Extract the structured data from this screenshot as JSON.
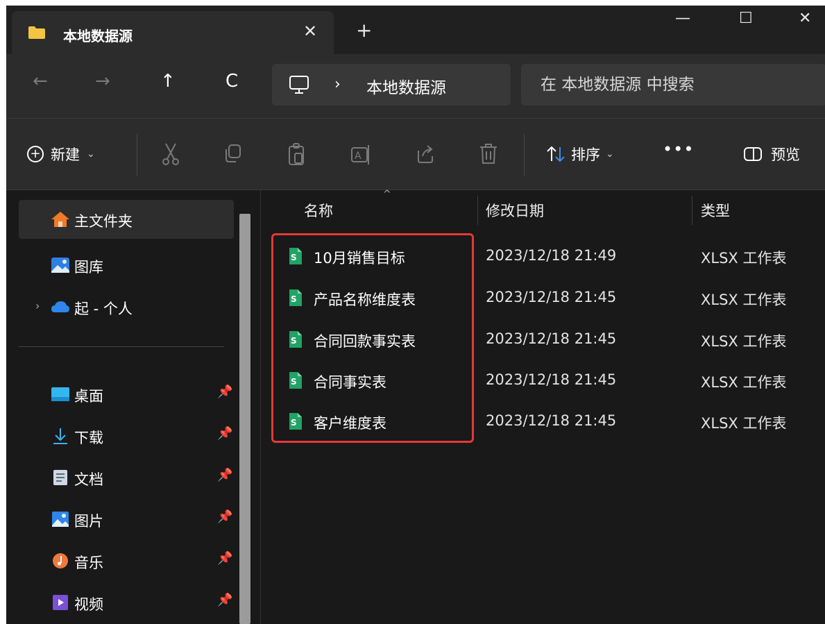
{
  "tab": {
    "title": "本地数据源",
    "close": "✕",
    "new_tab": "+"
  },
  "window_controls": {
    "minimize": "—",
    "maximize": "☐",
    "close": "✕"
  },
  "nav": {
    "back": "←",
    "forward": "→",
    "up": "↑",
    "refresh": "C"
  },
  "address": {
    "separator": "›",
    "crumb": "本地数据源"
  },
  "search": {
    "placeholder": "在 本地数据源 中搜索"
  },
  "toolbar": {
    "new_label": "新建",
    "caret": "⌄",
    "sort_label": "排序",
    "more_label": "•••",
    "preview_label": "预览"
  },
  "sidebar": {
    "items": [
      {
        "label": "主文件夹",
        "icon": "home-icon"
      },
      {
        "label": "图库",
        "icon": "gallery-icon"
      },
      {
        "label": "起 - 个人",
        "icon": "onedrive-icon"
      },
      {
        "label": "桌面",
        "icon": "desktop-icon",
        "pinned": true
      },
      {
        "label": "下载",
        "icon": "download-icon",
        "pinned": true
      },
      {
        "label": "文档",
        "icon": "documents-icon",
        "pinned": true
      },
      {
        "label": "图片",
        "icon": "pictures-icon",
        "pinned": true
      },
      {
        "label": "音乐",
        "icon": "music-icon",
        "pinned": true
      },
      {
        "label": "视频",
        "icon": "videos-icon",
        "pinned": true
      }
    ],
    "pin_glyph": "📌",
    "expand_glyph": "›"
  },
  "columns": {
    "name": "名称",
    "modified": "修改日期",
    "type": "类型",
    "sort_indicator": "^"
  },
  "files": [
    {
      "name": "10月销售目标",
      "modified": "2023/12/18 21:49",
      "type": "XLSX 工作表"
    },
    {
      "name": "产品名称维度表",
      "modified": "2023/12/18 21:45",
      "type": "XLSX 工作表"
    },
    {
      "name": "合同回款事实表",
      "modified": "2023/12/18 21:45",
      "type": "XLSX 工作表"
    },
    {
      "name": "合同事实表",
      "modified": "2023/12/18 21:45",
      "type": "XLSX 工作表"
    },
    {
      "name": "客户维度表",
      "modified": "2023/12/18 21:45",
      "type": "XLSX 工作表"
    }
  ],
  "colors": {
    "accent_red": "#e53935",
    "sheet_green": "#21a366",
    "folder_yellow": "#f4c542"
  }
}
